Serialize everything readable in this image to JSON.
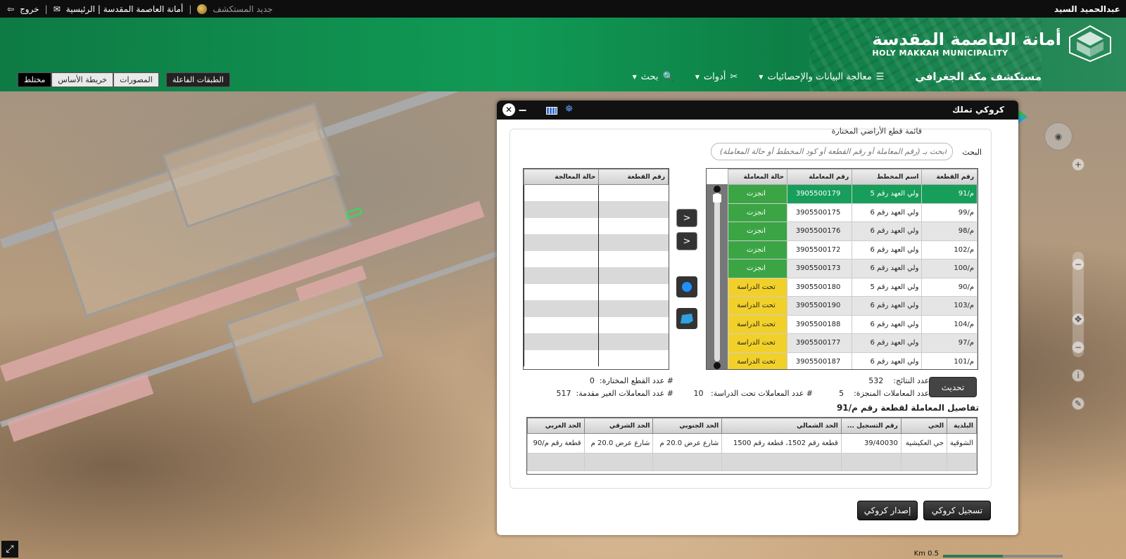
{
  "topbar": {
    "user": "عبدالحميد السيد",
    "logout": "خروج",
    "home_link": "أمانة العاصمة المقدسة | الرئيسية",
    "whats_new": "جديد المستكشف"
  },
  "logo": {
    "arabic": "أمانة العاصمة المقدسة",
    "english": "HOLY MAKKAH MUNICIPALITY"
  },
  "nav": {
    "brand": "مستكشف مكة الجغرافي",
    "items": [
      "معالجة البيانات والإحصائيات",
      "أدوات",
      "بحث"
    ]
  },
  "basemap_tabs": [
    "مختلط",
    "خريطة الأساس",
    "المصورات"
  ],
  "layers_button": "الطبقات الفاعلة",
  "dialog": {
    "title": "كروكي تملك",
    "list_title": "قائمة قطع الأراضي المختارة",
    "search_label": "البحث",
    "search_placeholder": "ابحث بـ (رقم المعاملة أو رقم القطعة أو كود المخطط أو حالة المعاملة)",
    "main_table": {
      "headers": [
        "رقم القطعة",
        "اسم المخطط",
        "رقم المعاملة",
        "حالة المعاملة"
      ],
      "rows": [
        {
          "plot": "م/91",
          "plan": "ولي العهد رقم 5",
          "txn": "3905500179",
          "status": "انجزت",
          "kind": "done"
        },
        {
          "plot": "م/99",
          "plan": "ولي العهد رقم 6",
          "txn": "3905500175",
          "status": "انجزت",
          "kind": "done"
        },
        {
          "plot": "م/98",
          "plan": "ولي العهد رقم 6",
          "txn": "3905500176",
          "status": "انجزت",
          "kind": "done"
        },
        {
          "plot": "م/102",
          "plan": "ولي العهد رقم 6",
          "txn": "3905500172",
          "status": "انجزت",
          "kind": "done"
        },
        {
          "plot": "م/100",
          "plan": "ولي العهد رقم 6",
          "txn": "3905500173",
          "status": "انجزت",
          "kind": "done"
        },
        {
          "plot": "م/90",
          "plan": "ولي العهد رقم 5",
          "txn": "3905500180",
          "status": "تحت الدراسة",
          "kind": "study"
        },
        {
          "plot": "م/103",
          "plan": "ولي العهد رقم 6",
          "txn": "3905500190",
          "status": "تحت الدراسة",
          "kind": "study"
        },
        {
          "plot": "م/104",
          "plan": "ولي العهد رقم 6",
          "txn": "3905500188",
          "status": "تحت الدراسة",
          "kind": "study"
        },
        {
          "plot": "م/97",
          "plan": "ولي العهد رقم 6",
          "txn": "3905500177",
          "status": "تحت الدراسة",
          "kind": "study"
        },
        {
          "plot": "م/101",
          "plan": "ولي العهد رقم 6",
          "txn": "3905500187",
          "status": "تحت الدراسة",
          "kind": "study"
        }
      ]
    },
    "selected_table": {
      "headers": [
        "رقم القطعة",
        "حالة المعالجة"
      ]
    },
    "stats": {
      "results_label": "# عدد النتائج:",
      "results_value": "532",
      "selected_label": "# عدد القطع المختارة:",
      "selected_value": "0",
      "done_label": "# عدد المعاملات المنجزة:",
      "done_value": "5",
      "study_label": "# عدد المعاملات تحت الدراسة:",
      "study_value": "10",
      "unsubmitted_label": "# عدد المعاملات الغير مقدمة:",
      "unsubmitted_value": "517"
    },
    "refresh_button": "تحديث",
    "details_title": "تفاصيل المعاملة لقطعة رقم م/91",
    "details_table": {
      "headers": [
        "البلدية",
        "الحي",
        "رقم التسجيل ...",
        "الحد الشمالي",
        "الحد الجنوبي",
        "الحد الشرقي",
        "الحد الغربي"
      ],
      "row": [
        "الشوقية",
        "حي العكيشية",
        "39/40030",
        "قطعة رقم 1502، قطعة رقم 1500",
        "شارع عرض 20.0 م",
        "شارع عرض 20.0 م",
        "قطعة رقم م/90"
      ]
    },
    "register_button": "تسجيل كروكي",
    "issue_button": "إصدار كروكي",
    "move_right": ">",
    "move_left": ">"
  },
  "map": {
    "scale_label": "Km 0.5"
  }
}
